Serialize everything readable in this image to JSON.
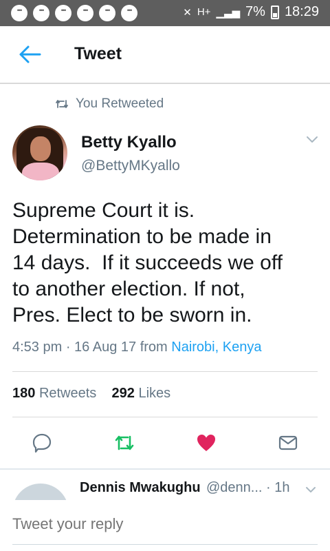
{
  "status_bar": {
    "time": "18:29",
    "battery": "7%",
    "network": "H+",
    "notification_icons": [
      "bbm-icon",
      "chat-icon",
      "chat-icon",
      "chat-icon",
      "chat-icon",
      "chat-icon"
    ]
  },
  "header": {
    "title": "Tweet"
  },
  "context": {
    "retweet_label": "You Retweeted"
  },
  "tweet": {
    "author_name": "Betty Kyallo",
    "author_handle": "@BettyMKyallo",
    "text": "Supreme Court it is.\nDetermination to be made in\n14 days.  If it succeeds we off\nto another election. If not,\nPres. Elect to be sworn in.",
    "time": "4:53 pm · 16 Aug 17",
    "from_label": "from",
    "location": "Nairobi, Kenya",
    "retweets_count": "180",
    "retweets_label": "Retweets",
    "likes_count": "292",
    "likes_label": "Likes"
  },
  "actions": {
    "reply_icon": "reply-icon",
    "retweet_icon": "retweet-icon",
    "like_icon": "heart-icon",
    "dm_icon": "envelope-icon"
  },
  "reply_preview": {
    "name": "Dennis Mwakughu",
    "handle_time": "@denn... · 1h"
  },
  "reply_box": {
    "placeholder": "Tweet your reply"
  },
  "colors": {
    "accent": "#1da1f2",
    "retweet_green": "#17bf63",
    "like_red": "#e0245e",
    "secondary_text": "#657786",
    "status_bar": "#5e5e5e"
  }
}
